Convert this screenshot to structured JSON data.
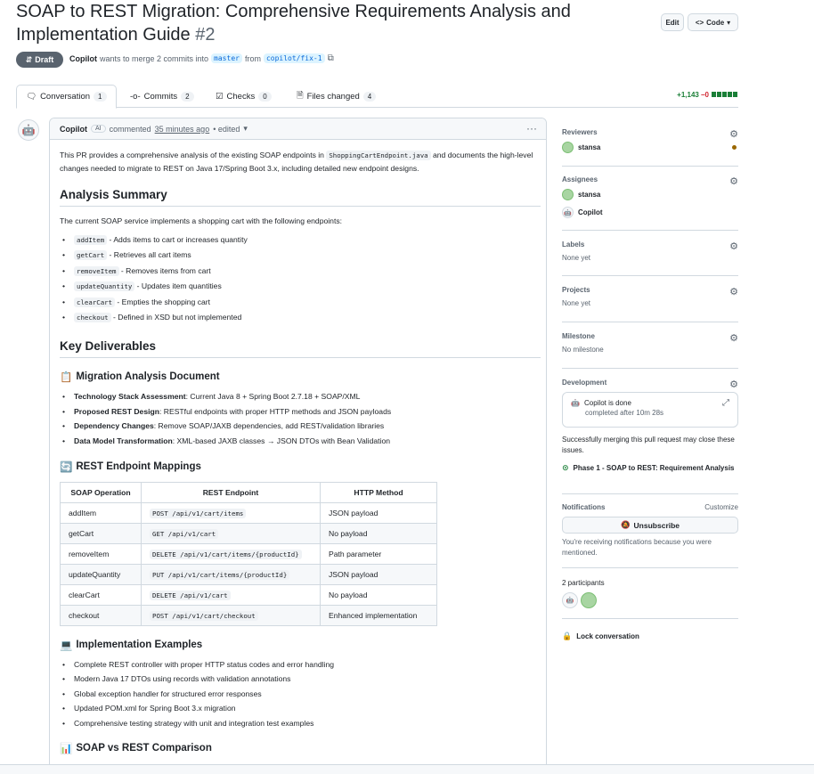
{
  "header": {
    "title_line1": "SOAP to REST Migration: Comprehensive Requirements Analysis and",
    "title_line2": "Implementation Guide",
    "pr_number": "#2",
    "edit_label": "Edit",
    "code_label": "Code"
  },
  "status": {
    "draft_label": "Draft",
    "author": "Copilot",
    "merge_text": "wants to merge 2 commits into",
    "base_branch": "master",
    "from_text": "from",
    "head_branch": "copilot/fix-1"
  },
  "tabs": [
    {
      "label": "Conversation",
      "count": "1"
    },
    {
      "label": "Commits",
      "count": "2"
    },
    {
      "label": "Checks",
      "count": "0"
    },
    {
      "label": "Files changed",
      "count": "4"
    }
  ],
  "diffstat": {
    "additions": "+1,143",
    "deletions": "−0"
  },
  "comment": {
    "author": "Copilot",
    "badge": "AI",
    "action": "commented",
    "time": "35 minutes ago",
    "edited": "• edited",
    "intro_1": "This PR provides a comprehensive analysis of the existing SOAP endpoints in",
    "intro_code": "ShoppingCartEndpoint.java",
    "intro_2": "and documents",
    "intro_3": "the high-level changes needed to migrate to REST on Java 17/Spring Boot 3.x, including detailed new endpoint designs.",
    "analysis_heading": "Analysis Summary",
    "analysis_text": "The current SOAP service implements a shopping cart with the following endpoints:",
    "endpoints": [
      {
        "code": "addItem",
        "text": " - Adds items to cart or increases quantity"
      },
      {
        "code": "getCart",
        "text": " - Retrieves all cart items"
      },
      {
        "code": "removeItem",
        "text": " - Removes items from cart"
      },
      {
        "code": "updateQuantity",
        "text": " - Updates item quantities"
      },
      {
        "code": "clearCart",
        "text": " - Empties the shopping cart"
      },
      {
        "code": "checkout",
        "text": " - Defined in XSD but not implemented"
      }
    ],
    "deliverables_heading": "Key Deliverables",
    "doc_heading": "Migration Analysis Document",
    "doc_items": [
      {
        "bold": "Technology Stack Assessment",
        "text": ": Current Java 8 + Spring Boot 2.7.18 + SOAP/XML"
      },
      {
        "bold": "Proposed REST Design",
        "text": ": RESTful endpoints with proper HTTP methods and JSON payloads"
      },
      {
        "bold": "Dependency Changes",
        "text": ": Remove SOAP/JAXB dependencies, add REST/validation libraries"
      },
      {
        "bold": "Data Model Transformation",
        "text": ": XML-based JAXB classes → JSON DTOs with Bean Validation"
      }
    ],
    "mappings_heading": "REST Endpoint Mappings",
    "table_headers": [
      "SOAP Operation",
      "REST Endpoint",
      "HTTP Method"
    ],
    "table_rows": [
      [
        "addItem",
        "POST /api/v1/cart/items",
        "JSON payload"
      ],
      [
        "getCart",
        "GET /api/v1/cart",
        "No payload"
      ],
      [
        "removeItem",
        "DELETE /api/v1/cart/items/{productId}",
        "Path parameter"
      ],
      [
        "updateQuantity",
        "PUT /api/v1/cart/items/{productId}",
        "JSON payload"
      ],
      [
        "clearCart",
        "DELETE /api/v1/cart",
        "No payload"
      ],
      [
        "checkout",
        "POST /api/v1/cart/checkout",
        "Enhanced implementation"
      ]
    ],
    "impl_heading": "Implementation Examples",
    "impl_items": [
      "Complete REST controller with proper HTTP status codes and error handling",
      "Modern Java 17 DTOs using records with validation annotations",
      "Global exception handler for structured error responses",
      "Updated POM.xml for Spring Boot 3.x migration",
      "Comprehensive testing strategy with unit and integration test examples"
    ],
    "comparison_heading": "SOAP vs REST Comparison"
  },
  "sidebar": {
    "reviewers_label": "Reviewers",
    "reviewer": "stansa",
    "assignees_label": "Assignees",
    "assignee_1": "stansa",
    "assignee_2": "Copilot",
    "labels_label": "Labels",
    "labels_value": "None yet",
    "projects_label": "Projects",
    "projects_value": "None yet",
    "milestone_label": "Milestone",
    "milestone_value": "No milestone",
    "development_label": "Development",
    "dev_status": "Copilot is done",
    "dev_sub": "completed after 10m 28s",
    "merge_note": "Successfully merging this pull request may close these issues.",
    "issue": "Phase 1 - SOAP to REST: Requirement Analysis",
    "notifications_label": "Notifications",
    "customize_label": "Customize",
    "unsubscribe_label": "Unsubscribe",
    "notif_note": "You're receiving notifications because you were mentioned.",
    "participants_label": "2 participants",
    "lock_label": "Lock conversation"
  }
}
